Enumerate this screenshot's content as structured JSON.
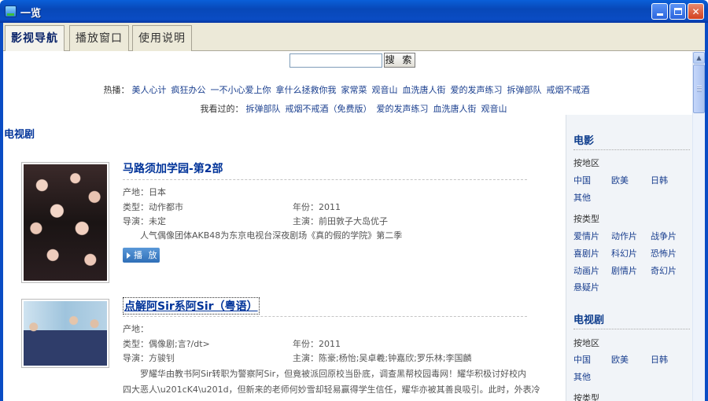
{
  "window": {
    "title": "一览",
    "minimize_icon": "minimize-icon",
    "maximize_icon": "maximize-icon",
    "close_icon": "close-icon",
    "close_glyph": "✕"
  },
  "tabs": [
    {
      "label": "影视导航",
      "active": true
    },
    {
      "label": "播放窗口",
      "active": false
    },
    {
      "label": "使用说明",
      "active": false
    }
  ],
  "search": {
    "value": "",
    "button_label": "搜 索"
  },
  "hot": {
    "label": "热播：",
    "items": [
      "美人心计",
      "疯狂办公",
      "一不小心爱上你",
      "拿什么拯救你我",
      "家常菜",
      "观音山",
      "血洗唐人街",
      "爱的发声练习",
      "拆弹部队",
      "戒烟不戒酒"
    ]
  },
  "seen": {
    "label": "我看过的：",
    "items": [
      "拆弹部队",
      "戒烟不戒酒（免费版）",
      "爱的发声练习",
      "血洗唐人街",
      "观音山"
    ]
  },
  "section_title": "电视剧",
  "items": [
    {
      "title": "马路须加学园-第2部",
      "origin_label": "产地：",
      "origin": "日本",
      "genre_label": "类型：",
      "genre": "动作都市",
      "year_label": "年份：",
      "year": "2011",
      "director_label": "导演：",
      "director": "未定",
      "cast_label": "主演：",
      "cast": "前田敦子大岛优子",
      "description": "人气偶像团体AKB48为东京电视台深夜剧场《真的假的学院》第二季",
      "play_label": "播 放"
    },
    {
      "title": "点解阿Sir系阿Sir（粤语）",
      "origin_label": "产地：",
      "origin": "",
      "genre_label": "类型：",
      "genre": "偶像剧;言?/dt>",
      "year_label": "年份：",
      "year": "2011",
      "director_label": "导演：",
      "director": "方骏钊",
      "cast_label": "主演：",
      "cast": "陈豪;杨怡;吴卓羲;钟嘉欣;罗乐林;李国麟",
      "description_lines": [
        "罗耀华由教书阿Sir转职为警察阿Sir，但竟被派回原校当卧底，调查黑帮校园毒网！耀华积极讨好校内",
        "四大恶人\\u201cK4\\u201d，但新来的老师何妙雪却轻易赢得学生信任，耀华亦被其善良吸引。此时，外表冷"
      ]
    }
  ],
  "sidebar": {
    "movie": {
      "heading": "电影",
      "region_label": "按地区",
      "regions": [
        "中国",
        "欧美",
        "日韩",
        "其他"
      ],
      "type_label": "按类型",
      "types": [
        "爱情片",
        "动作片",
        "战争片",
        "喜剧片",
        "科幻片",
        "恐怖片",
        "动画片",
        "剧情片",
        "奇幻片",
        "悬疑片"
      ]
    },
    "tv": {
      "heading": "电视剧",
      "region_label": "按地区",
      "regions": [
        "中国",
        "欧美",
        "日韩",
        "其他"
      ],
      "type_label": "按类型"
    }
  }
}
